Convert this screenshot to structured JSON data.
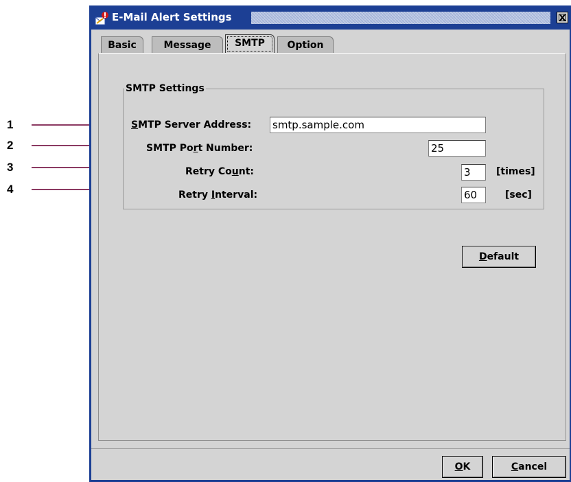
{
  "callouts": [
    "1",
    "2",
    "3",
    "4"
  ],
  "window": {
    "title": "E-Mail Alert Settings",
    "close_glyph": "x"
  },
  "tabs": [
    {
      "label": "Basic"
    },
    {
      "label": "Message"
    },
    {
      "label": "SMTP",
      "active": true
    },
    {
      "label": "Option"
    }
  ],
  "smtp": {
    "group_title": "SMTP Settings",
    "server_address": {
      "label_mnemonic": "S",
      "label_rest": "MTP Server Address:",
      "value": "smtp.sample.com"
    },
    "port_number": {
      "label_pre": "SMTP Po",
      "label_mnemonic": "r",
      "label_post": "t Number:",
      "value": "25"
    },
    "retry_count": {
      "label_pre": "Retry Co",
      "label_mnemonic": "u",
      "label_post": "nt:",
      "value": "3",
      "unit": "[times]"
    },
    "retry_interval": {
      "label_pre": "Retry ",
      "label_mnemonic": "I",
      "label_post": "nterval:",
      "value": "60",
      "unit": "[sec]"
    }
  },
  "buttons": {
    "default": {
      "mnemonic": "D",
      "rest": "efault"
    },
    "ok": {
      "mnemonic": "O",
      "rest": "K"
    },
    "cancel": {
      "mnemonic": "C",
      "rest": "ancel"
    }
  },
  "colors": {
    "titlebar": "#1c3f94",
    "panel": "#d4d4d4",
    "callout_line": "#8b3a62"
  }
}
